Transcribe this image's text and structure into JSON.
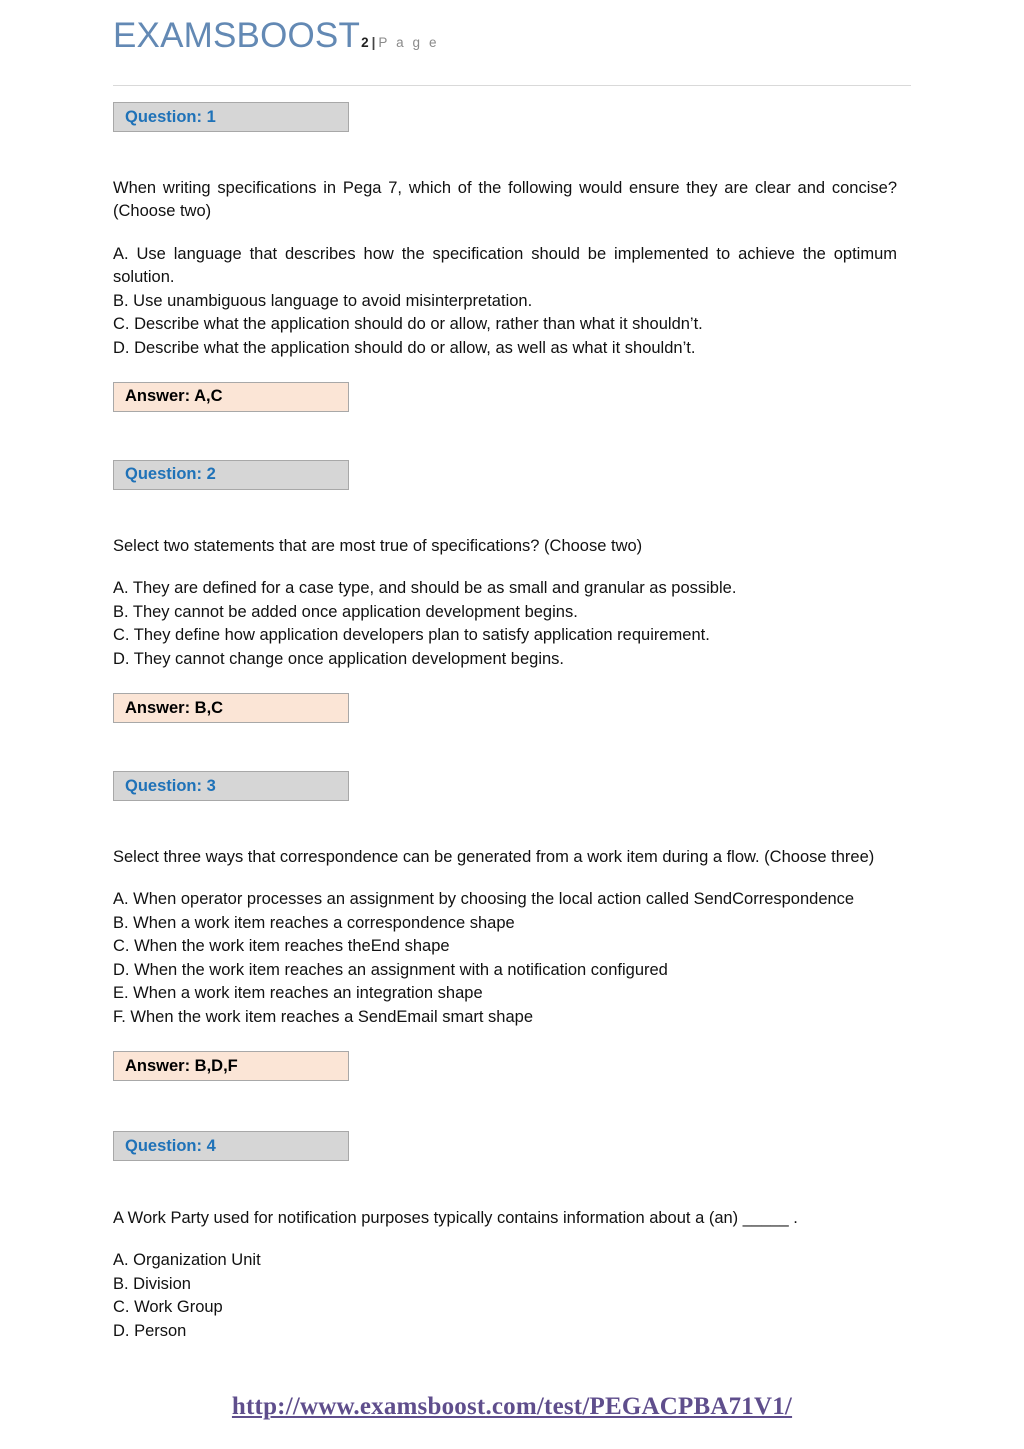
{
  "header": {
    "brand": "EXAMSBOOST",
    "page_number": "2",
    "separator": "|",
    "page_word": "P a g e"
  },
  "colors": {
    "brand_blue": "#6389b4",
    "question_label_blue": "#1f72b8",
    "question_box_bg": "#d6d6d6",
    "answer_box_bg": "#fbe5d6",
    "footer_link": "#5f4e8c",
    "rule": "#d9d9d9"
  },
  "questions": [
    {
      "label": "Question: 1",
      "stem": "When writing specifications in Pega 7, which of the following would ensure they are clear and concise? (Choose two)",
      "options": [
        "A. Use language that describes how the specification should be implemented to achieve the optimum solution.",
        "B. Use unambiguous language to avoid misinterpretation.",
        "C. Describe what the application should do or allow, rather than what it shouldn’t.",
        "D. Describe what the application should do or allow, as well as what it shouldn’t."
      ],
      "answer_label": "Answer: A,C"
    },
    {
      "label": "Question: 2",
      "stem": "Select two statements that are most true of specifications? (Choose two)",
      "options": [
        "A. They are defined for a case type, and should be as small and granular as possible.",
        "B. They cannot be added once application development begins.",
        "C. They define how application developers plan to satisfy application requirement.",
        "D. They cannot change once application development begins."
      ],
      "answer_label": "Answer: B,C"
    },
    {
      "label": "Question: 3",
      "stem": "Select three ways that correspondence can be generated from a work item during a flow. (Choose three)",
      "options": [
        "A. When operator processes an assignment by choosing the local action called SendCorrespondence",
        "B. When a work item reaches a correspondence shape",
        "C. When the work item reaches theEnd shape",
        "D. When the work item reaches an assignment with a notification configured",
        "E. When a work item reaches an integration shape",
        "F. When the work item reaches a SendEmail smart shape"
      ],
      "answer_label": "Answer: B,D,F"
    },
    {
      "label": "Question: 4",
      "stem": "A Work Party used for notification purposes typically contains information about a (an) _____ .",
      "options": [
        "A. Organization Unit",
        "B. Division",
        "C. Work Group",
        "D. Person"
      ],
      "answer_label": null
    }
  ],
  "footer": {
    "url": "http://www.examsboost.com/test/PEGACPBA71V1/"
  }
}
